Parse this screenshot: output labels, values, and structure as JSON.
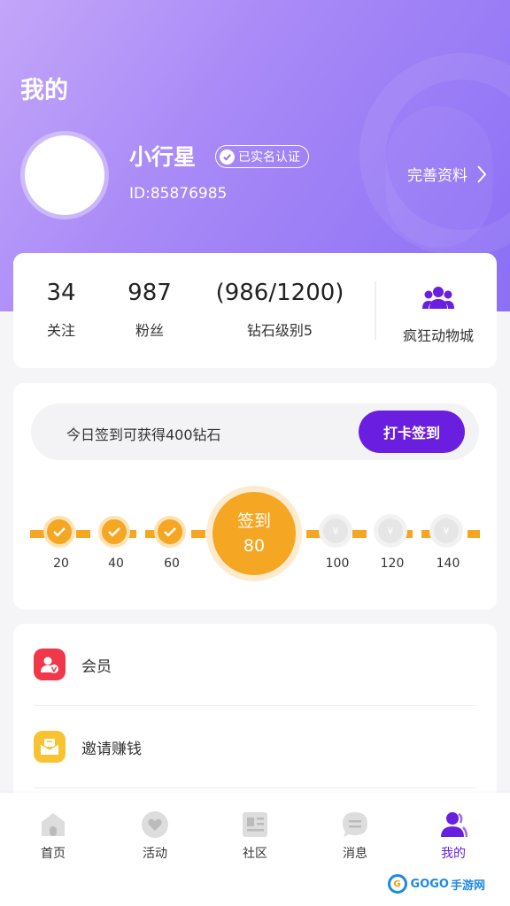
{
  "header": {
    "title": "我的",
    "username": "小行星",
    "verified_label": "已实名认证",
    "user_id": "ID:85876985",
    "edit_profile": "完善资料"
  },
  "stats": {
    "following_count": "34",
    "following_label": "关注",
    "fans_count": "987",
    "fans_label": "粉丝",
    "diamond_progress": "(986/1200)",
    "diamond_level": "钻石级别5",
    "mall_label": "疯狂动物城"
  },
  "checkin": {
    "reward_text": "今日签到可获得400钻石",
    "button_label": "打卡签到",
    "today_label": "签到",
    "today_value": "80",
    "currency_symbol": "¥",
    "days_done": [
      "20",
      "40",
      "60"
    ],
    "days_future": [
      "100",
      "120",
      "140"
    ]
  },
  "menu": {
    "items": [
      {
        "label": "会员",
        "icon": "member-icon"
      },
      {
        "label": "邀请赚钱",
        "icon": "invite-icon"
      }
    ]
  },
  "tabbar": {
    "tabs": [
      {
        "label": "首页",
        "icon": "home-icon"
      },
      {
        "label": "活动",
        "icon": "activity-icon"
      },
      {
        "label": "社区",
        "icon": "community-icon"
      },
      {
        "label": "消息",
        "icon": "message-icon"
      },
      {
        "label": "我的",
        "icon": "profile-icon",
        "active": true
      }
    ]
  },
  "watermark": {
    "text": "GOGO",
    "suffix": "手游网"
  },
  "colors": {
    "accent": "#6a1fe0",
    "orange": "#f5a623",
    "header_start": "#c3a6f9",
    "header_end": "#8b6ff5"
  }
}
